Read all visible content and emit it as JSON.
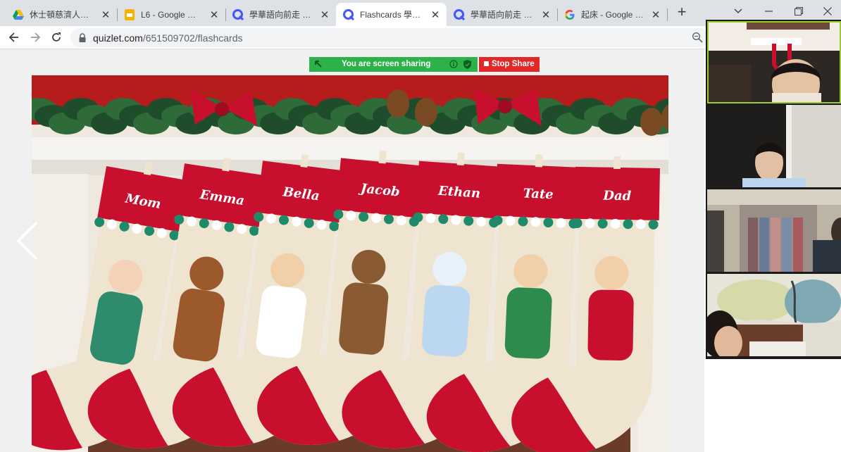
{
  "browser": {
    "tabs": [
      {
        "title": "休士頓慈濟人文學校",
        "favicon": "google-drive-icon",
        "active": false
      },
      {
        "title": "L6 - Google 簡報",
        "favicon": "google-slides-icon",
        "active": false
      },
      {
        "title": "學華語向前走 第三冊",
        "favicon": "quizlet-icon",
        "active": false
      },
      {
        "title": "Flashcards 學華語向前走",
        "favicon": "quizlet-icon",
        "active": true
      },
      {
        "title": "學華語向前走 第三冊",
        "favicon": "quizlet-icon",
        "active": false
      },
      {
        "title": "起床 - Google 搜尋",
        "favicon": "google-icon",
        "active": false
      }
    ],
    "tab_close_glyph": "✕",
    "new_tab_glyph": "+",
    "url_domain": "quizlet.com",
    "url_path": "/651509702/flashcards"
  },
  "screen_share": {
    "status_text": "You are screen sharing",
    "stop_label": "Stop Share"
  },
  "flashcard": {
    "stocking_names": [
      "Mom",
      "Emma",
      "Bella",
      "Jacob",
      "Ethan",
      "Tate",
      "Dad"
    ]
  },
  "video_participants": [
    {
      "speaking": true
    },
    {
      "speaking": false
    },
    {
      "speaking": false
    },
    {
      "speaking": false
    }
  ],
  "colors": {
    "tabstrip_bg": "#dee1e6",
    "share_green": "#2db24a",
    "share_red": "#e02828",
    "quizlet_blue": "#4255ff",
    "stocking_red": "#c8102e",
    "stocking_cream": "#efe4cf",
    "speaker_border": "#9acd32"
  }
}
